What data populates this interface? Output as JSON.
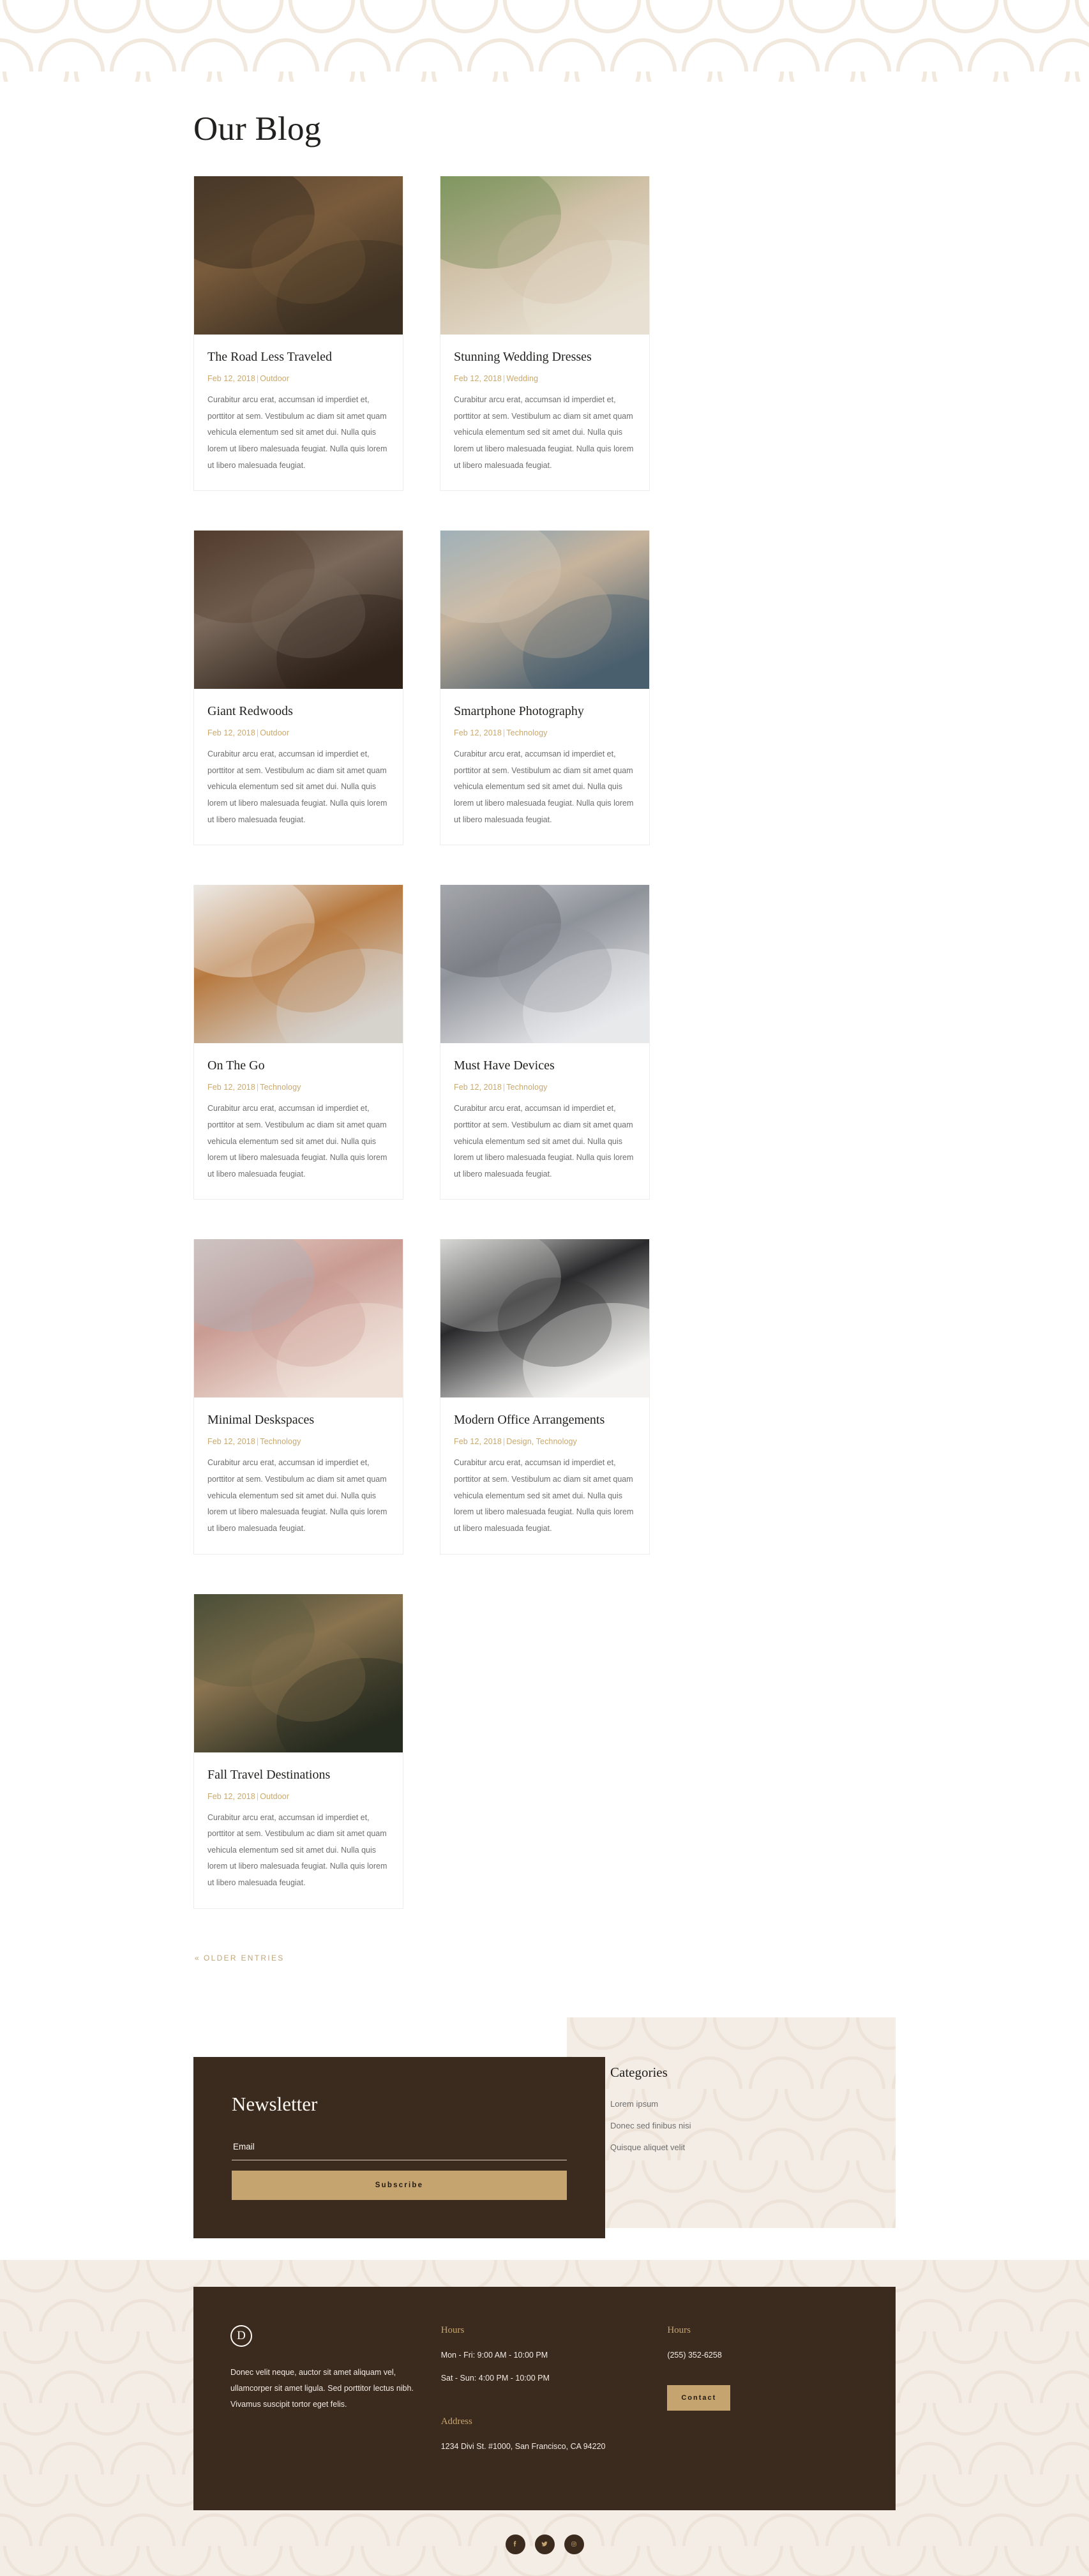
{
  "page": {
    "title": "Our Blog"
  },
  "posts": [
    {
      "title": "The Road Less Traveled",
      "date": "Feb 12, 2018",
      "categories": "Outdoor",
      "excerpt": "Curabitur arcu erat, accumsan id imperdiet et, porttitor at sem. Vestibulum ac diam sit amet quam vehicula elementum sed sit amet dui. Nulla quis lorem ut libero malesuada feugiat. Nulla quis lorem ut libero malesuada feugiat.",
      "image": "autumn-forest-road"
    },
    {
      "title": "Stunning Wedding Dresses",
      "date": "Feb 12, 2018",
      "categories": "Wedding",
      "excerpt": "Curabitur arcu erat, accumsan id imperdiet et, porttitor at sem. Vestibulum ac diam sit amet quam vehicula elementum sed sit amet dui. Nulla quis lorem ut libero malesuada feugiat. Nulla quis lorem ut libero malesuada feugiat.",
      "image": "bride-in-white-dress"
    },
    {
      "title": "Giant Redwoods",
      "date": "Feb 12, 2018",
      "categories": "Outdoor",
      "excerpt": "Curabitur arcu erat, accumsan id imperdiet et, porttitor at sem. Vestibulum ac diam sit amet quam vehicula elementum sed sit amet dui. Nulla quis lorem ut libero malesuada feugiat. Nulla quis lorem ut libero malesuada feugiat.",
      "image": "redwood-tree-trunks"
    },
    {
      "title": "Smartphone Photography",
      "date": "Feb 12, 2018",
      "categories": "Technology",
      "excerpt": "Curabitur arcu erat, accumsan id imperdiet et, porttitor at sem. Vestibulum ac diam sit amet quam vehicula elementum sed sit amet dui. Nulla quis lorem ut libero malesuada feugiat. Nulla quis lorem ut libero malesuada feugiat.",
      "image": "hands-holding-camera-mountains"
    },
    {
      "title": "On The Go",
      "date": "Feb 12, 2018",
      "categories": "Technology",
      "excerpt": "Curabitur arcu erat, accumsan id imperdiet et, porttitor at sem. Vestibulum ac diam sit amet quam vehicula elementum sed sit amet dui. Nulla quis lorem ut libero malesuada feugiat. Nulla quis lorem ut libero malesuada feugiat.",
      "image": "phone-on-leather-case"
    },
    {
      "title": "Must Have Devices",
      "date": "Feb 12, 2018",
      "categories": "Technology",
      "excerpt": "Curabitur arcu erat, accumsan id imperdiet et, porttitor at sem. Vestibulum ac diam sit amet quam vehicula elementum sed sit amet dui. Nulla quis lorem ut libero malesuada feugiat. Nulla quis lorem ut libero malesuada feugiat.",
      "image": "laptop-keyboard-closeup"
    },
    {
      "title": "Minimal Deskspaces",
      "date": "Feb 12, 2018",
      "categories": "Technology",
      "excerpt": "Curabitur arcu erat, accumsan id imperdiet et, porttitor at sem. Vestibulum ac diam sit amet quam vehicula elementum sed sit amet dui. Nulla quis lorem ut libero malesuada feugiat. Nulla quis lorem ut libero malesuada feugiat.",
      "image": "pink-keyboard-desk"
    },
    {
      "title": "Modern Office Arrangements",
      "date": "Feb 12, 2018",
      "categories": "Design, Technology",
      "excerpt": "Curabitur arcu erat, accumsan id imperdiet et, porttitor at sem. Vestibulum ac diam sit amet quam vehicula elementum sed sit amet dui. Nulla quis lorem ut libero malesuada feugiat. Nulla quis lorem ut libero malesuada feugiat.",
      "image": "imac-desk-lamp"
    },
    {
      "title": "Fall Travel Destinations",
      "date": "Feb 12, 2018",
      "categories": "Outdoor",
      "excerpt": "Curabitur arcu erat, accumsan id imperdiet et, porttitor at sem. Vestibulum ac diam sit amet quam vehicula elementum sed sit amet dui. Nulla quis lorem ut libero malesuada feugiat. Nulla quis lorem ut libero malesuada feugiat.",
      "image": "pinecone-on-moss"
    }
  ],
  "pagination": {
    "older_chevron": "«",
    "older_label": "Older Entries"
  },
  "newsletter": {
    "title": "Newsletter",
    "email_placeholder": "Email",
    "email_value": "",
    "subscribe_label": "Subscribe"
  },
  "categories_panel": {
    "title": "Categories",
    "items": [
      "Lorem ipsum",
      "Donec sed finibus nisi",
      "Quisque aliquet velit"
    ]
  },
  "footer": {
    "logo_letter": "D",
    "description": "Donec velit neque, auctor sit amet aliquam vel, ullamcorper sit amet ligula. Sed porttitor lectus nibh. Vivamus suscipit tortor eget felis.",
    "hours_heading": "Hours",
    "hours_lines": [
      "Mon - Fri: 9:00 AM - 10:00 PM",
      "Sat - Sun: 4:00 PM - 10:00 PM"
    ],
    "address_heading": "Address",
    "address_line": "1234 Divi St. #1000, San Francisco, CA 94220",
    "phone_heading": "Hours",
    "phone": "(255) 352-6258",
    "contact_label": "Contact",
    "social": [
      "facebook-icon",
      "twitter-icon",
      "instagram-icon"
    ]
  },
  "colors": {
    "gold": "#C6A46F",
    "meta_gold": "#C9A86C",
    "dark_brown": "#3B2A1E",
    "cream": "#F4EDE6",
    "pattern": "#EDE3D8",
    "body_text": "#6E6E6E",
    "heading": "#22211F"
  }
}
